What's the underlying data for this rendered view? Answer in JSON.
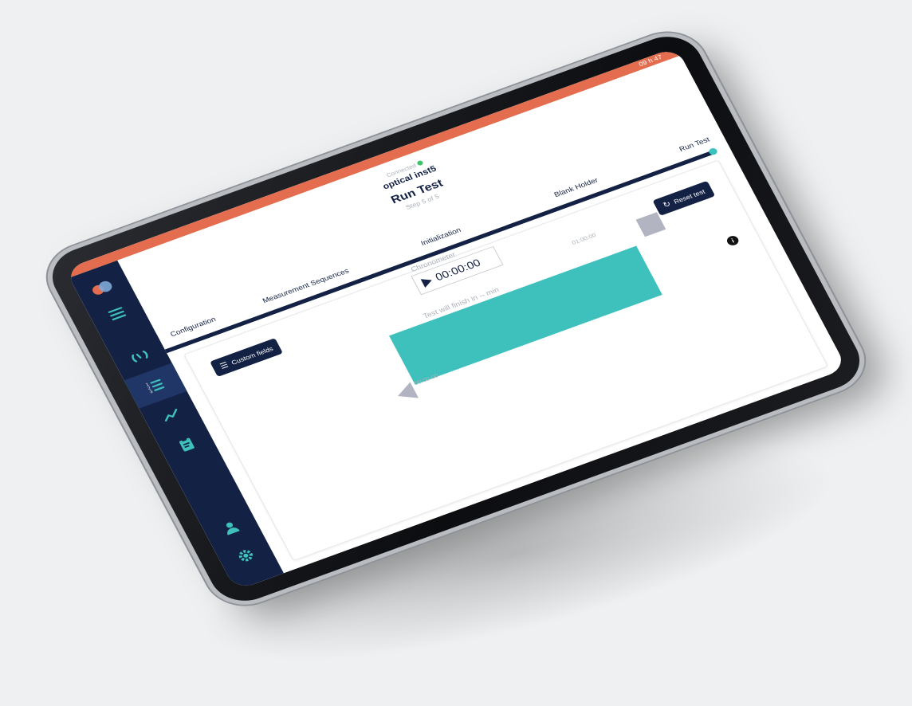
{
  "status_bar": {
    "time": "09 h 47"
  },
  "header": {
    "connection_status": "Connected",
    "device_name": "optical inst5",
    "step_title": "Run Test",
    "step_subtitle": "Step 5 of 5"
  },
  "steps": [
    {
      "label": "Configuration"
    },
    {
      "label": "Measurement Sequences"
    },
    {
      "label": "Initialization"
    },
    {
      "label": "Blank Holder"
    },
    {
      "label": "Run Test"
    }
  ],
  "progress": {
    "completed_fraction": 1.0
  },
  "actions": {
    "custom_fields": "Custom fields",
    "reset_test": "Reset test"
  },
  "chronometer": {
    "label": "Chronometer",
    "time": "00:00:00"
  },
  "timeline": {
    "finish_text": "Test will finish in -- min",
    "start_time": "00:00:00",
    "end_time": "01:00:00"
  },
  "sidebar": {
    "items": [
      {
        "icon": "menu-icon"
      },
      {
        "icon": "gauge-icon"
      },
      {
        "icon": "numbered-list-icon"
      },
      {
        "icon": "trend-line-icon"
      },
      {
        "icon": "clipboard-icon"
      },
      {
        "icon": "user-icon"
      },
      {
        "icon": "gear-icon"
      }
    ]
  },
  "colors": {
    "navy": "#132144",
    "teal": "#3ec1bc",
    "coral": "#e46d4f",
    "muted": "#aab0b8",
    "connected": "#3cc46b"
  }
}
